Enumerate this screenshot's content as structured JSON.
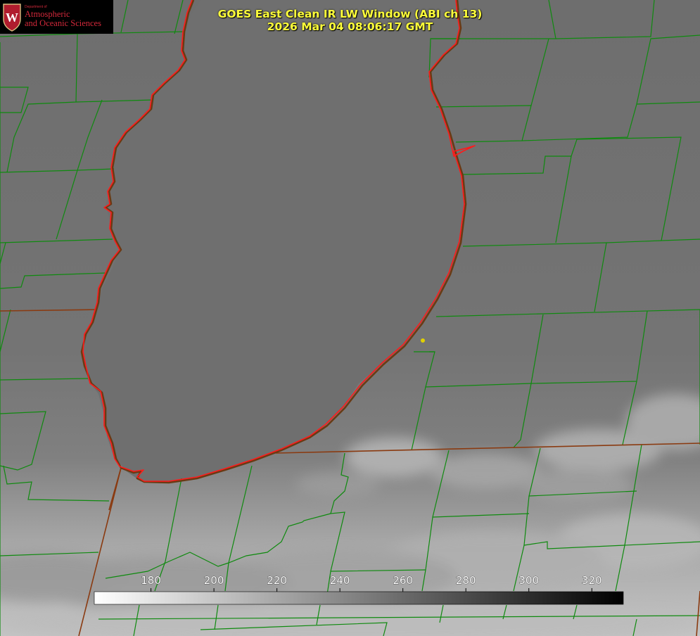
{
  "header": {
    "title_line1": "GOES East Clean IR LW Window (ABI ch 13)",
    "title_line2": "2026 Mar 04 08:06:17 GMT"
  },
  "logo": {
    "dept_label": "Department of",
    "line1": "Atmospheric",
    "line2": "and Oceanic Sciences",
    "crest_letter": "W"
  },
  "colorbar": {
    "tick_labels": [
      "180",
      "200",
      "220",
      "240",
      "260",
      "280",
      "300",
      "320"
    ],
    "range": [
      162,
      330
    ],
    "direction": "white-to-black"
  },
  "colors": {
    "county_lines": "#0f8a0f",
    "state_lines": "#8a3a10",
    "lake_shoreline": "#ff1a1a",
    "title_text": "#ffff3a",
    "station_marker": "#e0d000"
  },
  "icons": {
    "logo": "university-crest-icon",
    "station": "station-dot-icon"
  }
}
